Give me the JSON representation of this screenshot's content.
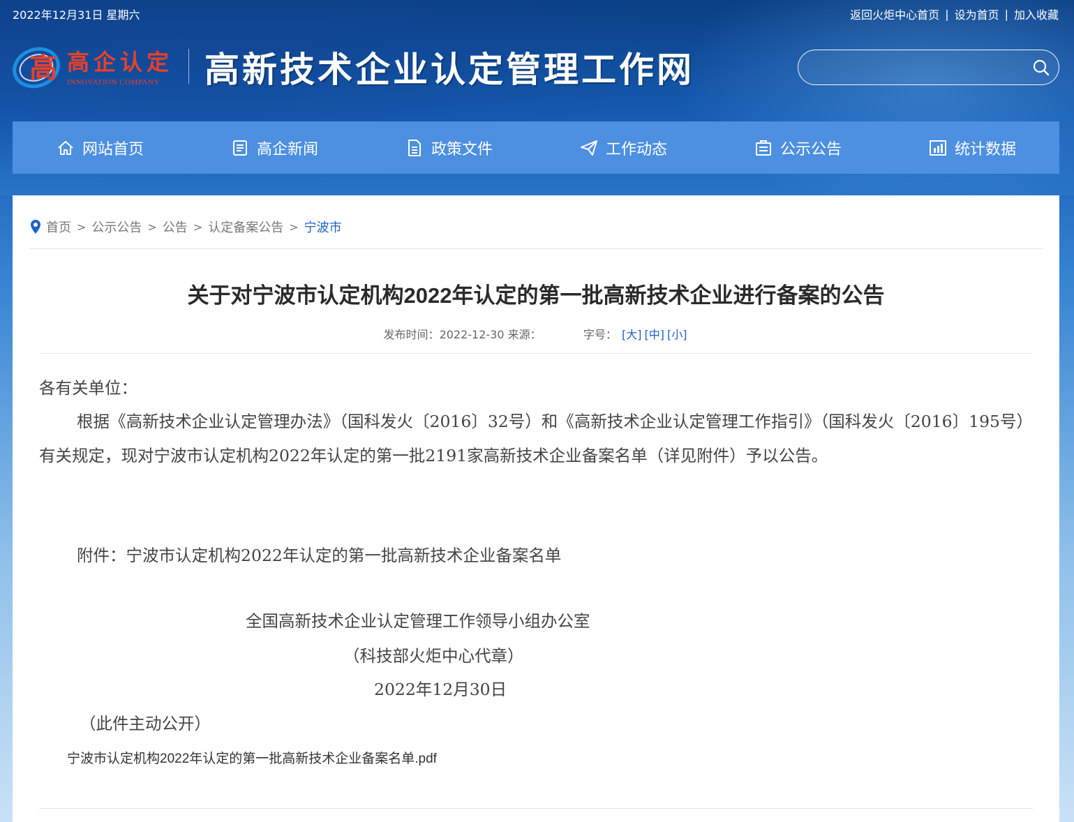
{
  "topbar": {
    "date": "2022年12月31日 星期六",
    "links": [
      "返回火炬中心首页",
      "设为首页",
      "加入收藏"
    ]
  },
  "logo": {
    "name_cn": "高企认定",
    "name_en": "INNOVATION COMPANY"
  },
  "site_title": "高新技术企业认定管理工作网",
  "search": {
    "placeholder": "",
    "value": "",
    "icon": "search-icon"
  },
  "nav": [
    {
      "label": "网站首页",
      "icon": "home-icon"
    },
    {
      "label": "高企新闻",
      "icon": "news-icon"
    },
    {
      "label": "政策文件",
      "icon": "document-icon"
    },
    {
      "label": "工作动态",
      "icon": "paper-plane-icon"
    },
    {
      "label": "公示公告",
      "icon": "notice-icon"
    },
    {
      "label": "统计数据",
      "icon": "chart-icon"
    }
  ],
  "breadcrumb": {
    "items": [
      "首页",
      "公示公告",
      "公告",
      "认定备案公告"
    ],
    "current": "宁波市",
    "separator": ">"
  },
  "article": {
    "title": "关于对宁波市认定机构2022年认定的第一批高新技术企业进行备案的公告",
    "meta": {
      "publish_label": "发布时间：",
      "publish_date": "2022-12-30",
      "source_label": "来源：",
      "font_label": "字号：",
      "font_large": "[大]",
      "font_medium": "[中]",
      "font_small": "[小]"
    },
    "greeting": "各有关单位：",
    "body": "根据《高新技术企业认定管理办法》（国科发火〔2016〕32号）和《高新技术企业认定管理工作指引》（国科发火〔2016〕195号）有关规定，现对宁波市认定机构2022年认定的第一批2191家高新技术企业备案名单（详见附件）予以公告。",
    "attachment_line": "附件：宁波市认定机构2022年认定的第一批高新技术企业备案名单",
    "signature_org": "全国高新技术企业认定管理工作领导小组办公室",
    "signature_seal": "（科技部火炬中心代章）",
    "signature_date": "2022年12月30日",
    "disclosure": "（此件主动公开）",
    "attachment_file": "宁波市认定机构2022年认定的第一批高新技术企业备案名单.pdf"
  },
  "colors": {
    "nav_bg": "#4d8fe0",
    "header_bg": "#155bb1",
    "link_blue": "#1e62c7",
    "logo_red": "#e8402a"
  }
}
